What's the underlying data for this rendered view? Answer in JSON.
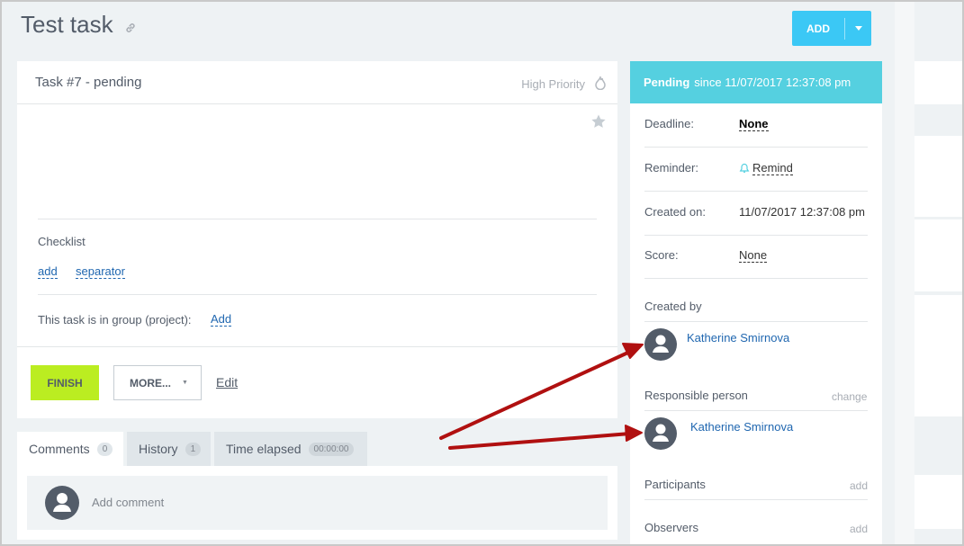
{
  "page": {
    "title": "Test task",
    "add_button": "ADD"
  },
  "task": {
    "header": "Task #7 - pending",
    "priority": "High Priority",
    "checklist_label": "Checklist",
    "checklist_add": "add",
    "checklist_separator": "separator",
    "group_label": "This task is in group (project):",
    "group_add": "Add",
    "finish_button": "FINISH",
    "more_button": "MORE...",
    "edit_link": "Edit"
  },
  "tabs": [
    {
      "label": "Comments",
      "count": "0"
    },
    {
      "label": "History",
      "count": "1"
    },
    {
      "label": "Time elapsed",
      "count": "00:00:00"
    }
  ],
  "comments": {
    "placeholder": "Add comment"
  },
  "sidebar": {
    "status_bold": "Pending",
    "status_rest": "since 11/07/2017 12:37:08 pm",
    "deadline_label": "Deadline:",
    "deadline_value": "None",
    "reminder_label": "Reminder:",
    "reminder_value": "Remind",
    "created_on_label": "Created on:",
    "created_on_value": "11/07/2017 12:37:08 pm",
    "score_label": "Score:",
    "score_value": "None",
    "created_by_label": "Created by",
    "created_by_name": "Katherine Smirnova",
    "responsible_label": "Responsible person",
    "responsible_change": "change",
    "responsible_name": "Katherine Smirnova",
    "participants_label": "Participants",
    "participants_add": "add",
    "observers_label": "Observers",
    "observers_add": "add"
  },
  "colors": {
    "accent": "#3bc8f5",
    "status_bar": "#55d0e0",
    "finish": "#bbed21",
    "link": "#2067b0",
    "annotation_arrow": "#b01010"
  }
}
